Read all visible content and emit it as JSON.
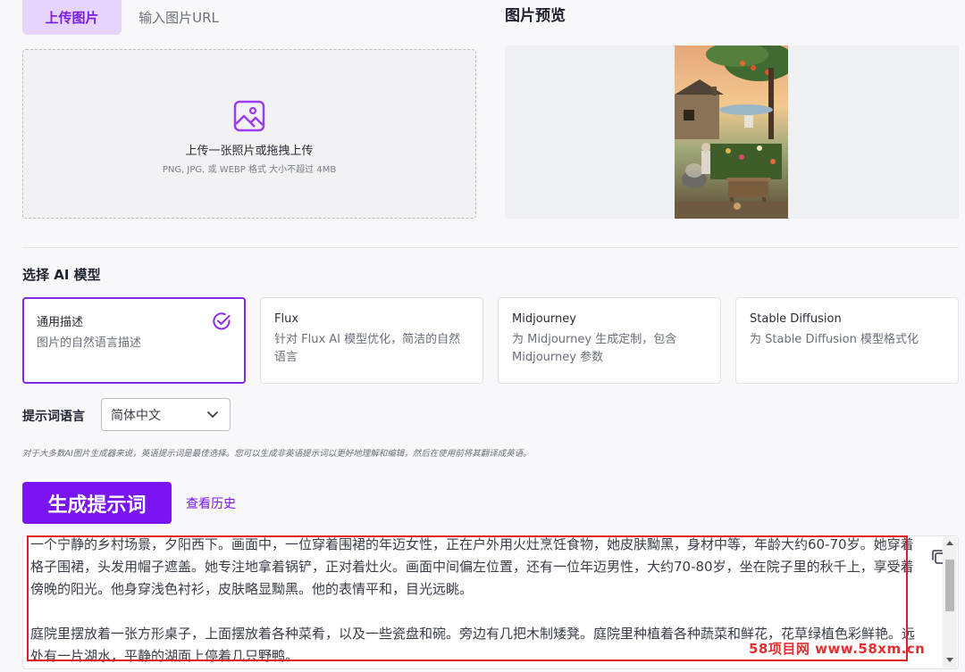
{
  "tabs": [
    {
      "label": "上传图片",
      "active": true
    },
    {
      "label": "输入图片URL",
      "active": false
    }
  ],
  "preview": {
    "title": "图片预览"
  },
  "upload": {
    "main_text": "上传一张照片或拖拽上传",
    "sub_text": "PNG, JPG, 或 WEBP 格式 大小不超过 4MB",
    "icon": "image-icon"
  },
  "models": {
    "section_title": "选择 AI 模型",
    "items": [
      {
        "title": "通用描述",
        "desc": "图片的自然语言描述",
        "selected": true
      },
      {
        "title": "Flux",
        "desc": "针对 Flux AI 模型优化，简洁的自然语言",
        "selected": false
      },
      {
        "title": "Midjourney",
        "desc": "为 Midjourney 生成定制，包含 Midjourney 参数",
        "selected": false
      },
      {
        "title": "Stable Diffusion",
        "desc": "为 Stable Diffusion 模型格式化",
        "selected": false
      }
    ]
  },
  "language": {
    "label": "提示词语言",
    "selected": "简体中文"
  },
  "hint": "对于大多数AI图片生成器来说，英语提示词是最佳选择。您可以生成非英语提示词以更好地理解和编辑，然后在使用前将其翻译成英语。",
  "actions": {
    "generate": "生成提示词",
    "history": "查看历史"
  },
  "output": {
    "paragraphs": [
      "一个宁静的乡村场景，夕阳西下。画面中，一位穿着围裙的年迈女性，正在户外用火灶烹饪食物，她皮肤黝黑，身材中等，年龄大约60-70岁。她穿着格子围裙，头发用帽子遮盖。她专注地拿着锅铲，正对着灶火。画面中间偏左位置，还有一位年迈男性，大约70-80岁，坐在院子里的秋千上，享受着傍晚的阳光。他身穿浅色衬衫，皮肤略显黝黑。他的表情平和，目光远眺。",
      "庭院里摆放着一张方形桌子，上面摆放着各种菜肴，以及一些瓷盘和碗。旁边有几把木制矮凳。庭院里种植着各种蔬菜和鲜花，花草绿植色彩鲜艳。远处有一片湖水，平静的湖面上停着几只野鸭。"
    ]
  },
  "watermark": "58项目网 www.58xm.cn",
  "colors": {
    "accent": "#7a14f0",
    "highlight": "#e02020"
  }
}
